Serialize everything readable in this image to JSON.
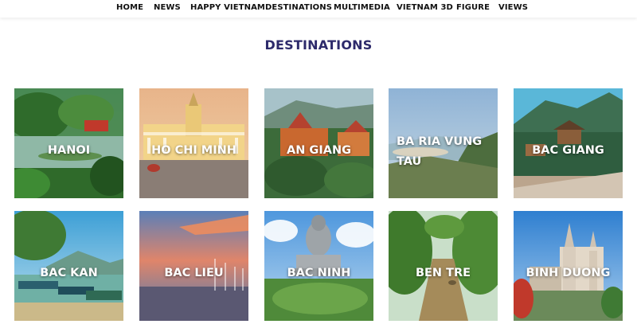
{
  "nav": {
    "items": [
      {
        "label": "HOME"
      },
      {
        "label": "NEWS"
      },
      {
        "label": "HAPPY VIETNAM"
      },
      {
        "label": "DESTINATIONS"
      },
      {
        "label": "MULTIMEDIA"
      },
      {
        "label": "VIETNAM 3D"
      },
      {
        "label": "FIGURE"
      },
      {
        "label": "VIEWS"
      }
    ]
  },
  "page": {
    "title": "DESTINATIONS"
  },
  "destinations": [
    {
      "label": "HANOI"
    },
    {
      "label": "HO CHI MINH"
    },
    {
      "label": "AN GIANG"
    },
    {
      "label": "BA RIA VUNG TAU"
    },
    {
      "label": "BAC GIANG"
    },
    {
      "label": "BAC KAN"
    },
    {
      "label": "BAC LIEU"
    },
    {
      "label": "BAC NINH"
    },
    {
      "label": "BEN TRE"
    },
    {
      "label": "BINH DUONG"
    }
  ],
  "colors": {
    "title": "#2d2a6b",
    "nav_text": "#111111",
    "label_text": "#ffffff"
  }
}
